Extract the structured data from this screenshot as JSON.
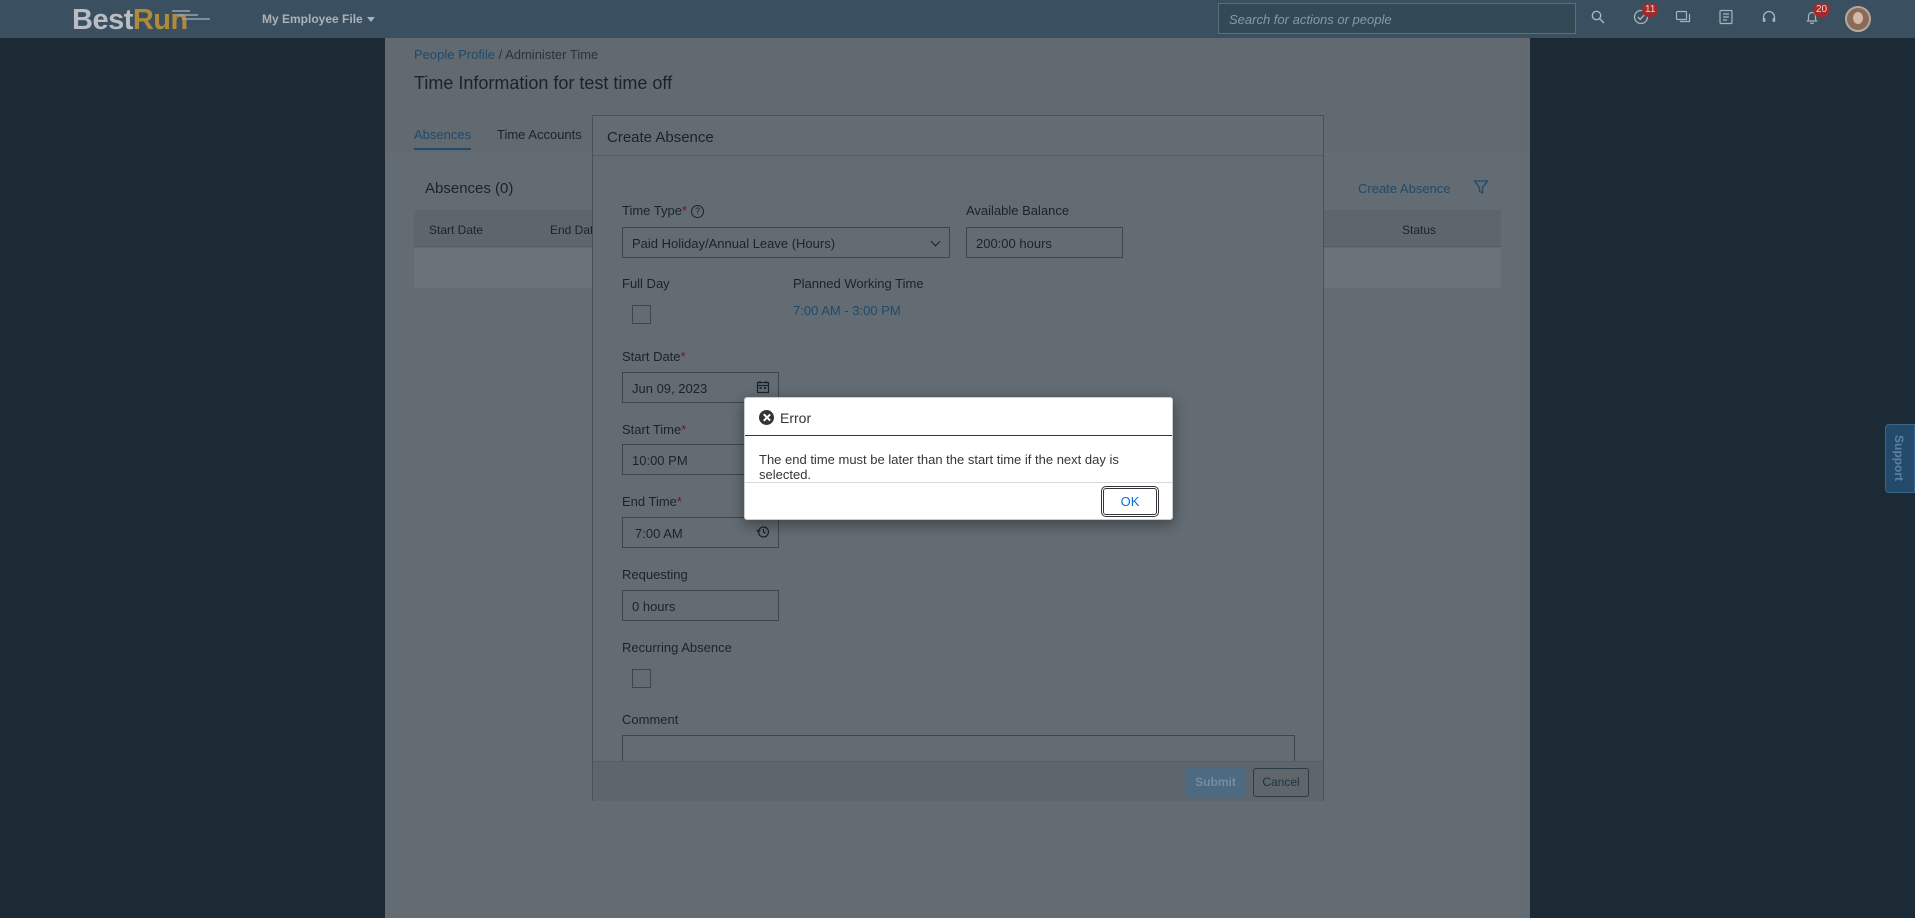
{
  "shell": {
    "logo_best": "Best",
    "logo_run": "Run",
    "employee_menu": "My Employee File",
    "search_placeholder": "Search for actions or people",
    "todo_badge": "11",
    "notifications_badge": "20"
  },
  "page": {
    "breadcrumb_link": "People Profile",
    "breadcrumb_sep": " / ",
    "breadcrumb_current": "Administer Time",
    "title": "Time Information for test time off",
    "tabs": [
      {
        "label": "Absences",
        "active": true
      },
      {
        "label": "Time Accounts",
        "active": false
      }
    ],
    "absences_heading": "Absences (0)",
    "create_absence_link": "Create Absence",
    "columns": {
      "start_date": "Start Date",
      "end_date": "End Dat",
      "status": "Status"
    }
  },
  "dialog": {
    "title": "Create Absence",
    "time_type_label": "Time Type",
    "time_type_value": "Paid Holiday/Annual Leave (Hours)",
    "available_balance_label": "Available Balance",
    "available_balance_value": "200:00 hours",
    "full_day_label": "Full Day",
    "planned_working_time_label": "Planned Working Time",
    "planned_working_time_value": "7:00 AM - 3:00 PM",
    "start_date_label": "Start Date",
    "start_date_value": "Jun 09, 2023",
    "start_time_label": "Start Time",
    "start_time_value": "10:00 PM",
    "end_time_label": "End Time",
    "end_time_value": "7:00 AM",
    "requesting_label": "Requesting",
    "requesting_value": "0 hours",
    "recurring_label": "Recurring Absence",
    "comment_label": "Comment",
    "submit_label": "Submit",
    "cancel_label": "Cancel",
    "required_marker": "*"
  },
  "error": {
    "title": "Error",
    "message": "The end time must be later than the start time if the next day is selected.",
    "ok_label": "OK"
  },
  "support": {
    "label": "Support"
  },
  "colors": {
    "shell": "#3a4f5f",
    "error_accent": "#bb0000",
    "link": "#0a6ed1"
  }
}
